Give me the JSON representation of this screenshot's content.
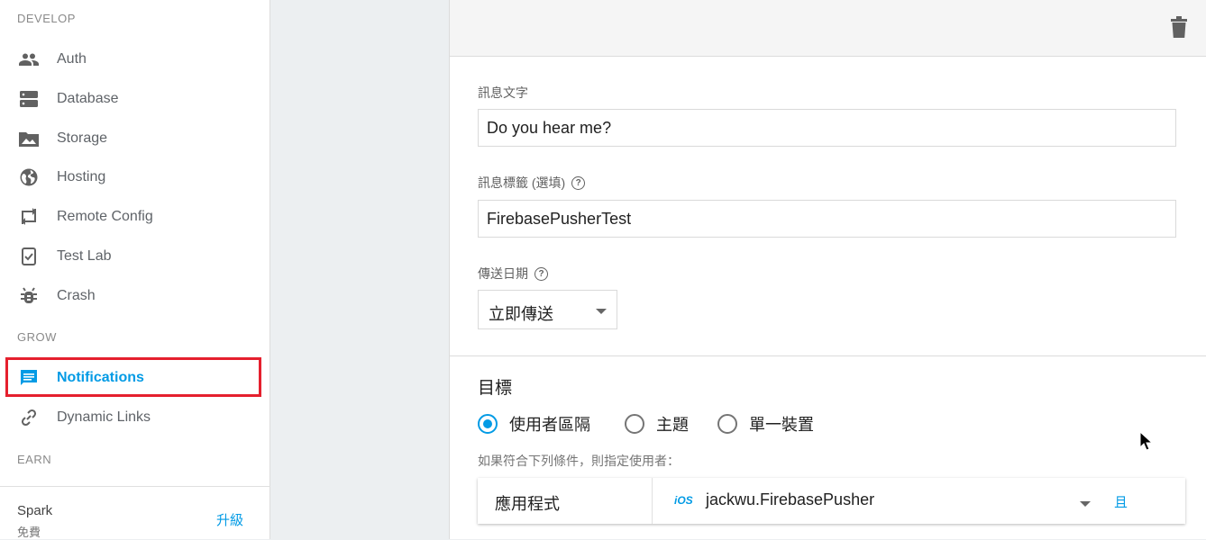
{
  "sidebar": {
    "sections": {
      "develop": "DEVELOP",
      "grow": "GROW",
      "earn": "EARN"
    },
    "items": [
      {
        "label": "Auth",
        "icon": "people-icon"
      },
      {
        "label": "Database",
        "icon": "database-icon"
      },
      {
        "label": "Storage",
        "icon": "image-icon"
      },
      {
        "label": "Hosting",
        "icon": "globe-icon"
      },
      {
        "label": "Remote Config",
        "icon": "remote-config-icon"
      },
      {
        "label": "Test Lab",
        "icon": "test-lab-icon"
      },
      {
        "label": "Crash",
        "icon": "bug-icon"
      },
      {
        "label": "Notifications",
        "icon": "chat-icon",
        "active": true
      },
      {
        "label": "Dynamic Links",
        "icon": "link-icon"
      }
    ],
    "plan": {
      "name": "Spark",
      "tier": "免費",
      "upgrade_label": "升級"
    }
  },
  "composer": {
    "message_text": {
      "label": "訊息文字",
      "value": "Do you hear me?"
    },
    "message_tag": {
      "label": "訊息標籤 (選填)",
      "value": "FirebasePusherTest"
    },
    "send_date": {
      "label": "傳送日期",
      "selected": "立即傳送"
    },
    "target": {
      "title": "目標",
      "options": [
        {
          "label": "使用者區隔",
          "checked": true
        },
        {
          "label": "主題",
          "checked": false
        },
        {
          "label": "單一裝置",
          "checked": false
        }
      ],
      "hint": "如果符合下列條件，則指定使用者：",
      "condition": {
        "label": "應用程式",
        "platform_badge": "iOS",
        "value": "jackwu.FirebasePusher",
        "and_label": "且"
      }
    }
  },
  "colors": {
    "accent": "#039be5",
    "highlight": "#e5202e"
  }
}
